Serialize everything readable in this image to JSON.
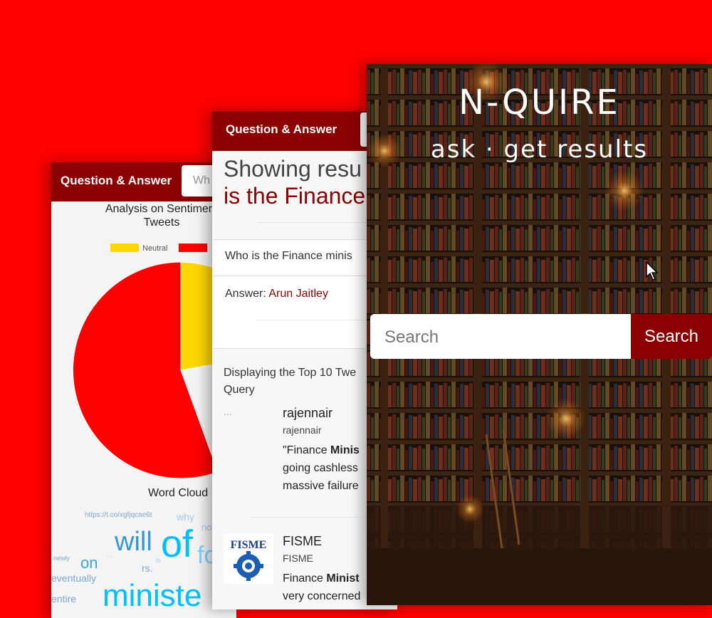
{
  "back_panel": {
    "brand": "Question & Answer",
    "search_placeholder": "Wh",
    "sentiment_title_line1": "Analysis on Sentiment",
    "sentiment_title_line2": "Tweets",
    "legend": [
      {
        "label": "Neutral",
        "color": "#ffd700"
      },
      {
        "label": "",
        "color": "#ff0000"
      }
    ],
    "word_cloud_title": "Word Cloud",
    "word_cloud_words": [
      {
        "text": "https://t.co/xgfjqcae6t",
        "color": "#7aa7d6"
      },
      {
        "text": "why",
        "color": "#a8c6e6"
      },
      {
        "text": "no",
        "color": "#a8c6e6"
      },
      {
        "text": "will",
        "color": "#3498db"
      },
      {
        "text": "of",
        "color": "#00bfff"
      },
      {
        "text": "fo",
        "color": "#7fd3ff"
      },
      {
        "text": "newly",
        "color": "#7aa7d6"
      },
      {
        "text": "...",
        "color": "#a8c6e6"
      },
      {
        "text": "on",
        "color": "#3aa3e0"
      },
      {
        "text": "is",
        "color": "#a8c6e6"
      },
      {
        "text": "rs.",
        "color": "#7aa7d6"
      },
      {
        "text": "eventually",
        "color": "#7aa7d6"
      },
      {
        "text": "entire",
        "color": "#7aa7d6"
      },
      {
        "text": "ministe",
        "color": "#00bfff"
      }
    ]
  },
  "middle_panel": {
    "brand": "Question & Answer",
    "heading_line1": "Showing resu",
    "heading_line2": "is the Finance",
    "question": "Who is the Finance minis",
    "answer_label": "Answer:",
    "answer_value": "Arun Jaitley",
    "display_text_line1": "Displaying the Top 10 Twe",
    "display_text_line2": "Query",
    "tweets": [
      {
        "dots": "...",
        "name": "rajennair",
        "handle": "rajennair",
        "text_prefix": "\"Finance ",
        "text_bold": "Minis",
        "text_line2": "going cashless",
        "text_line3": "massive failure"
      },
      {
        "logo": "FISME",
        "name": "FISME",
        "handle": "FISME",
        "text_prefix": "Finance ",
        "text_bold": "Minist",
        "text_line2": "very concerned"
      }
    ]
  },
  "front_panel": {
    "logo": "N-QUIRE",
    "tagline": "ask · get results",
    "search_placeholder": "Search",
    "search_button": "Search"
  }
}
